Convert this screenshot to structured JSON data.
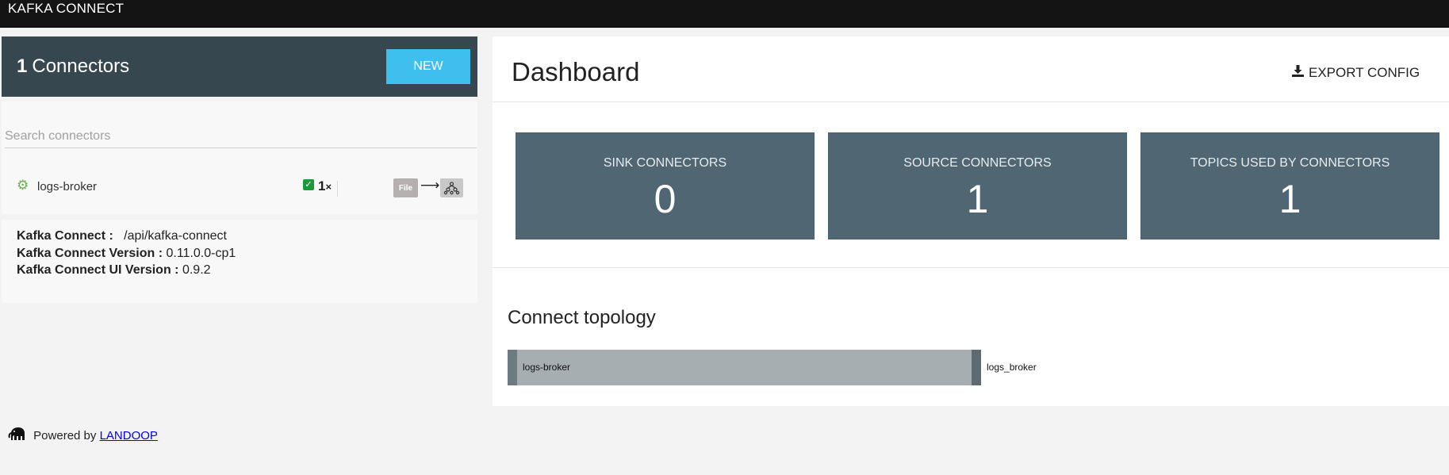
{
  "app": {
    "title": "KAFKA CONNECT"
  },
  "connectors_panel": {
    "count": "1",
    "count_label": "Connectors",
    "new_button": "NEW",
    "search_placeholder": "Search connectors",
    "items": [
      {
        "name": "logs-broker",
        "status_icon": "gear-icon",
        "status_color": "#6ab04c",
        "tasks": "1",
        "tasks_suffix": "×",
        "source_badge": "File",
        "target_icon": "kafka-icon"
      }
    ]
  },
  "info": {
    "connect_label": "Kafka Connect :",
    "connect_value": "/api/kafka-connect",
    "version_label": "Kafka Connect Version :",
    "version_value": "0.11.0.0-cp1",
    "ui_version_label": "Kafka Connect UI Version :",
    "ui_version_value": "0.9.2"
  },
  "footer": {
    "powered_by": "Powered by",
    "link": "LANDOOP"
  },
  "dashboard": {
    "title": "Dashboard",
    "export_button": "EXPORT CONFIG",
    "stats": [
      {
        "label": "SINK CONNECTORS",
        "value": "0"
      },
      {
        "label": "SOURCE CONNECTORS",
        "value": "1"
      },
      {
        "label": "TOPICS USED BY CONNECTORS",
        "value": "1"
      }
    ]
  },
  "topology": {
    "title": "Connect topology",
    "connector": "logs-broker",
    "topic": "logs_broker"
  },
  "colors": {
    "accent": "#3fbfed",
    "header_bg": "#37474f",
    "stat_bg": "#506673"
  }
}
